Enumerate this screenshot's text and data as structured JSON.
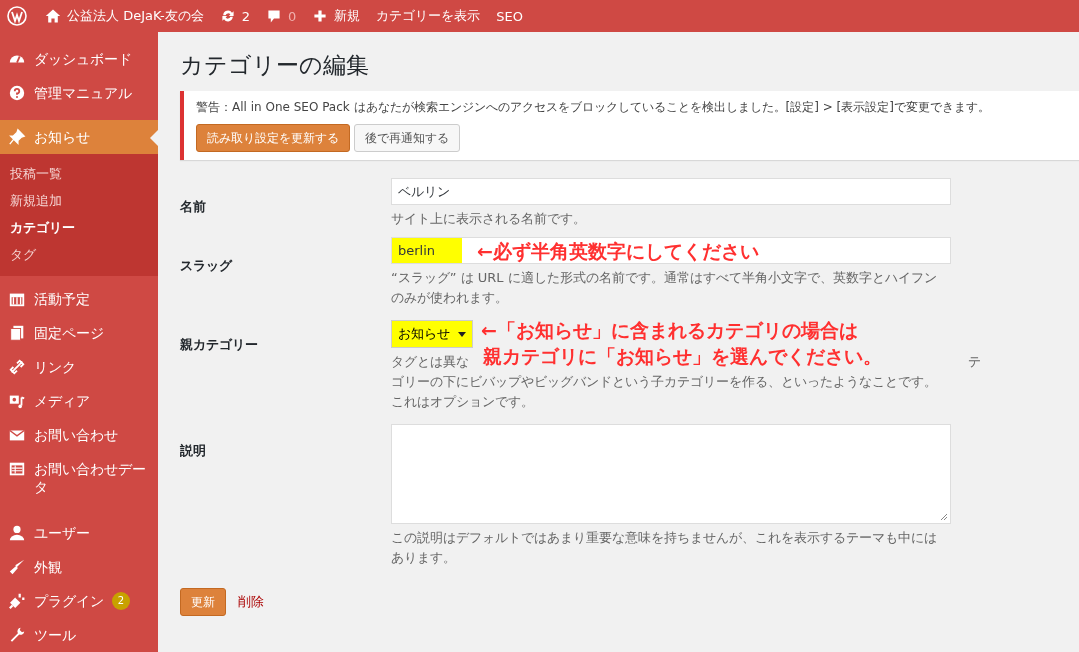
{
  "admin_bar": [
    {
      "kind": "logo"
    },
    {
      "kind": "site",
      "label": "公益法人 DeJaK-友の会"
    },
    {
      "kind": "updates",
      "label": "2"
    },
    {
      "kind": "comments",
      "label": "0"
    },
    {
      "kind": "new",
      "label": "新規"
    },
    {
      "kind": "link",
      "label": "カテゴリーを表示"
    },
    {
      "kind": "link",
      "label": "SEO"
    }
  ],
  "sidebar": {
    "items": [
      {
        "label": "ダッシュボード",
        "selected": false
      },
      {
        "label": "管理マニュアル",
        "selected": false
      },
      {
        "label": "お知らせ",
        "selected": true,
        "children": [
          {
            "label": "投稿一覧",
            "selected": false
          },
          {
            "label": "新規追加",
            "selected": false
          },
          {
            "label": "カテゴリー",
            "selected": true
          },
          {
            "label": "タグ",
            "selected": false
          }
        ]
      },
      {
        "label": "活動予定",
        "selected": false
      },
      {
        "label": "固定ページ",
        "selected": false
      },
      {
        "label": "リンク",
        "selected": false
      },
      {
        "label": "メディア",
        "selected": false
      },
      {
        "label": "お問い合わせ",
        "selected": false
      },
      {
        "label": "お問い合わせデータ",
        "selected": false
      },
      {
        "label": "ユーザー",
        "selected": false
      },
      {
        "label": "外観",
        "selected": false
      },
      {
        "label": "プラグイン",
        "selected": false,
        "badge": "2"
      },
      {
        "label": "ツール",
        "selected": false
      }
    ]
  },
  "page_title": "カテゴリーの編集",
  "notice": {
    "text": "警告：All in One SEO Pack はあなたが検索エンジンへのアクセスをブロックしていることを検出しました。[設定] > [表示設定]で変更できます。",
    "buttons": [
      {
        "label": "読み取り設定を更新する",
        "kind": "primary"
      },
      {
        "label": "後で再通知する",
        "kind": "secondary"
      }
    ]
  },
  "form": [
    {
      "kind": "text",
      "label": "名前",
      "value": "ベルリン",
      "help": [
        "サイト上に表示される名前です。"
      ]
    },
    {
      "kind": "text",
      "label": "スラッグ",
      "value": "berlin",
      "highlighted": true,
      "annotation": [
        "←必ず半角英数字にしてください"
      ],
      "help": [
        "“スラッグ” は URL に適した形式の名前です。通常はすべて半角小文字で、英数字とハイフン",
        "のみが使われます。"
      ]
    },
    {
      "kind": "select",
      "label": "親カテゴリー",
      "value": "お知らせ",
      "highlighted": true,
      "annotation": [
        "←「お知らせ」に含まれるカテゴリの場合は",
        "親カテゴリに「お知らせ」を選んでください。"
      ],
      "help_start": "タグとは異な",
      "help_end": "テ",
      "help": [
        "ゴリーの下にビバップやビッグバンドという子カテゴリーを作る、といったようなことです。",
        "これはオプションです。"
      ]
    },
    {
      "kind": "textarea",
      "label": "説明",
      "help": [
        "この説明はデフォルトではあまり重要な意味を持ちませんが、これを表示するテーマも中には",
        "あります。"
      ]
    }
  ],
  "actions": {
    "submit": "更新",
    "delete": "削除"
  }
}
